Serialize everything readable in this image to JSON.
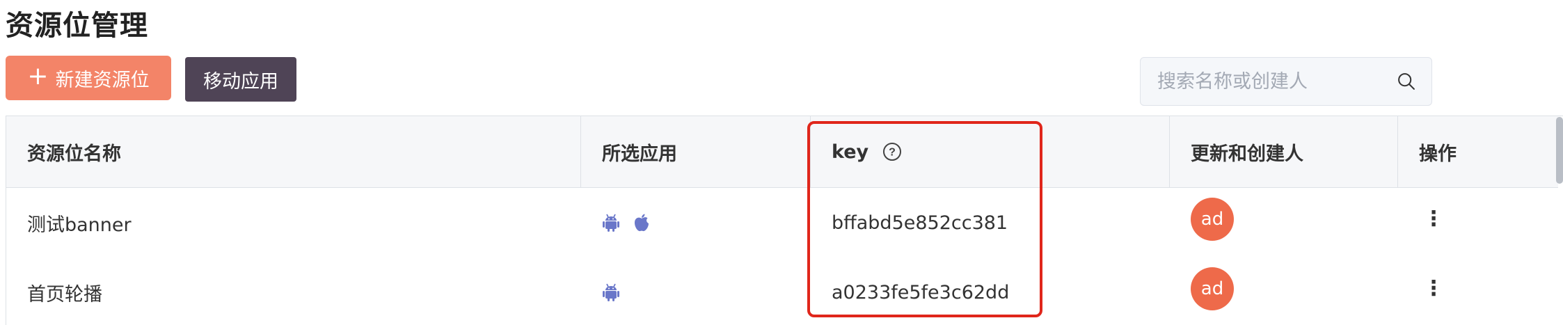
{
  "page": {
    "title": "资源位管理"
  },
  "toolbar": {
    "new_button_icon": "plus-icon",
    "new_button_label": "新建资源位",
    "mobile_app_label": "移动应用"
  },
  "search": {
    "placeholder": "搜索名称或创建人",
    "icon": "search-icon",
    "value": ""
  },
  "table": {
    "columns": {
      "name": "资源位名称",
      "apps": "所选应用",
      "key": "key",
      "key_help_icon": "help-circle-icon",
      "updater": "更新和创建人",
      "actions": "操作"
    },
    "rows": [
      {
        "name": "测试banner",
        "apps": [
          "android-icon",
          "apple-icon"
        ],
        "key": "bffabd5e852cc381",
        "avatar": "ad",
        "actions_icon": "more-vertical-icon",
        "actions_glyph": "⋮"
      },
      {
        "name": "首页轮播",
        "apps": [
          "android-icon"
        ],
        "key": "a0233fe5fe3c62dd",
        "avatar": "ad",
        "actions_icon": "more-vertical-icon",
        "actions_glyph": "⋮"
      }
    ]
  },
  "colors": {
    "primary_button": "#f38468",
    "secondary_button": "#4f4456",
    "avatar": "#ee6a4a",
    "platform_icon": "#6a77c9",
    "highlight": "#e0261b"
  }
}
